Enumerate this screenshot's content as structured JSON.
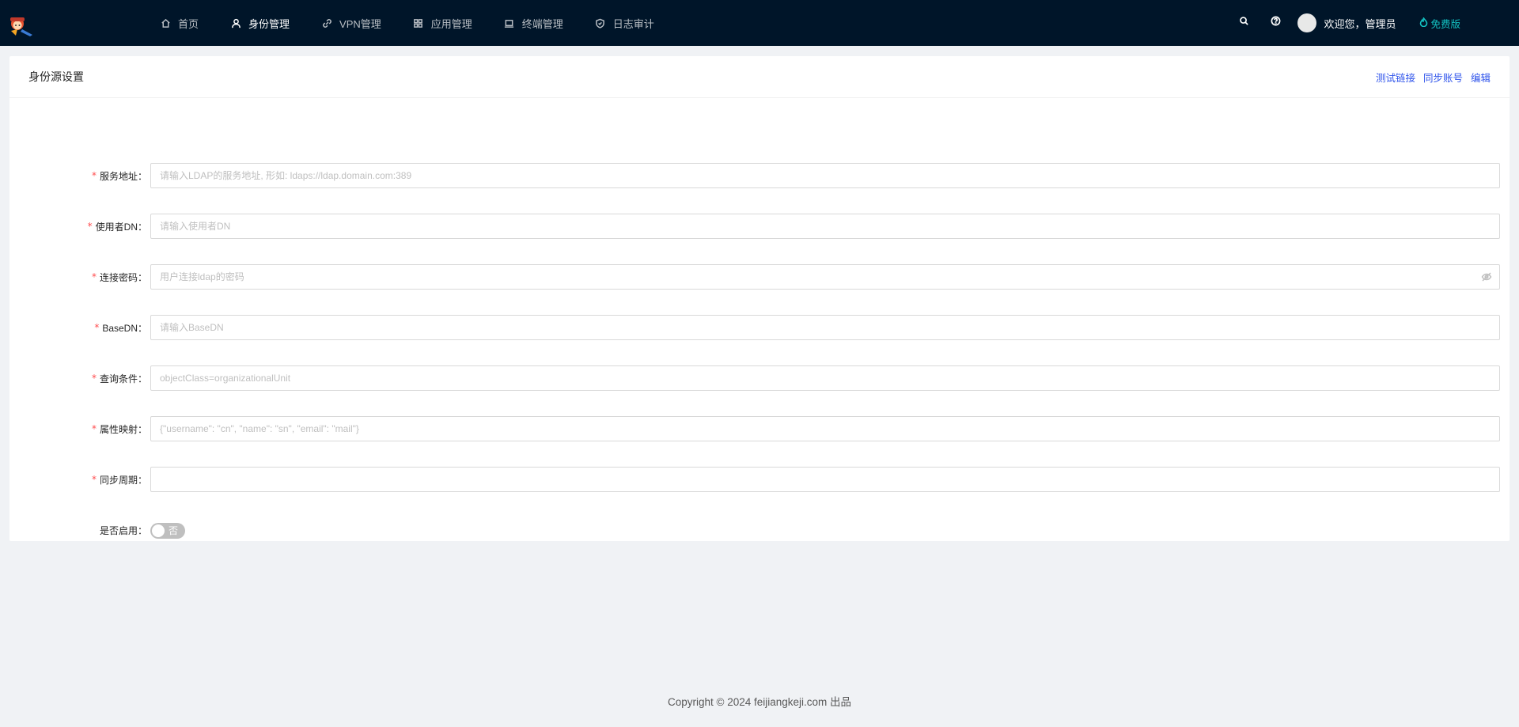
{
  "nav": {
    "items": [
      {
        "label": "首页",
        "icon": "home-icon"
      },
      {
        "label": "身份管理",
        "icon": "user-icon",
        "active": true
      },
      {
        "label": "VPN管理",
        "icon": "link-icon"
      },
      {
        "label": "应用管理",
        "icon": "apps-icon"
      },
      {
        "label": "终端管理",
        "icon": "laptop-icon"
      },
      {
        "label": "日志审计",
        "icon": "shield-icon"
      }
    ]
  },
  "header": {
    "welcome": "欢迎您，管理员",
    "plan": "免费版"
  },
  "card": {
    "title": "身份源设置",
    "actions": {
      "test_link": "测试链接",
      "sync_accounts": "同步账号",
      "edit": "编辑"
    }
  },
  "form": {
    "server": {
      "label": "服务地址：",
      "required": "*",
      "placeholder": "请输入LDAP的服务地址, 形如: ldaps://ldap.domain.com:389",
      "value": ""
    },
    "user_dn": {
      "label": "使用者DN：",
      "required": "*",
      "placeholder": "请输入使用者DN",
      "value": ""
    },
    "password": {
      "label": "连接密码：",
      "required": "*",
      "placeholder": "用户连接ldap的密码",
      "value": ""
    },
    "base_dn": {
      "label": "BaseDN：",
      "required": "*",
      "placeholder": "请输入BaseDN",
      "value": ""
    },
    "query": {
      "label": "查询条件：",
      "required": "*",
      "placeholder": "objectClass=organizationalUnit",
      "value": ""
    },
    "attr_map": {
      "label": "属性映射：",
      "required": "*",
      "placeholder": "{\"username\": \"cn\", \"name\": \"sn\", \"email\": \"mail\"}",
      "value": ""
    },
    "sync_period": {
      "label": "同步周期：",
      "required": "*",
      "placeholder": "",
      "value": ""
    },
    "enabled": {
      "label": "是否启用：",
      "state_text": "否",
      "checked": false
    }
  },
  "footer": {
    "copyright": "Copyright © 2024 feijiangkeji.com 出品"
  },
  "colors": {
    "topbar": "#001529",
    "link": "#2f54eb",
    "plan": "#13c2c2",
    "required": "#ff4d4f"
  }
}
